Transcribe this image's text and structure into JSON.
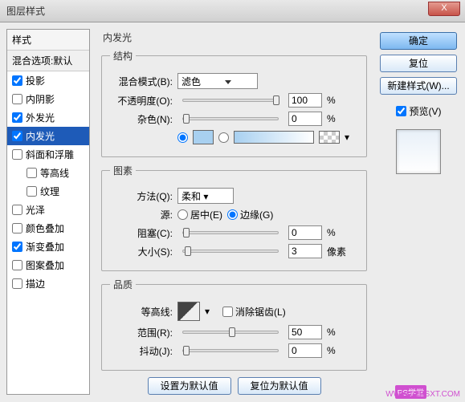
{
  "window": {
    "title": "图层样式",
    "close": "X"
  },
  "styles": {
    "header": "样式",
    "blend_default": "混合选项:默认",
    "items": [
      {
        "label": "投影",
        "checked": true
      },
      {
        "label": "内阴影",
        "checked": false
      },
      {
        "label": "外发光",
        "checked": true
      },
      {
        "label": "内发光",
        "checked": true,
        "selected": true
      },
      {
        "label": "斜面和浮雕",
        "checked": false
      },
      {
        "label": "等高线",
        "checked": false,
        "indent": true
      },
      {
        "label": "纹理",
        "checked": false,
        "indent": true
      },
      {
        "label": "光泽",
        "checked": false
      },
      {
        "label": "颜色叠加",
        "checked": false
      },
      {
        "label": "渐变叠加",
        "checked": true
      },
      {
        "label": "图案叠加",
        "checked": false
      },
      {
        "label": "描边",
        "checked": false
      }
    ]
  },
  "main": {
    "title": "内发光",
    "structure": {
      "legend": "结构",
      "blend_mode_label": "混合模式(B):",
      "blend_mode_value": "滤色",
      "opacity_label": "不透明度(O):",
      "opacity_value": "100",
      "opacity_unit": "%",
      "noise_label": "杂色(N):",
      "noise_value": "0",
      "noise_unit": "%"
    },
    "elements": {
      "legend": "图素",
      "method_label": "方法(Q):",
      "method_value": "柔和",
      "source_label": "源:",
      "source_center": "居中(E)",
      "source_edge": "边缘(G)",
      "choke_label": "阻塞(C):",
      "choke_value": "0",
      "choke_unit": "%",
      "size_label": "大小(S):",
      "size_value": "3",
      "size_unit": "像素"
    },
    "quality": {
      "legend": "品质",
      "contour_label": "等高线:",
      "antialias_label": "消除锯齿(L)",
      "range_label": "范围(R):",
      "range_value": "50",
      "range_unit": "%",
      "jitter_label": "抖动(J):",
      "jitter_value": "0",
      "jitter_unit": "%"
    },
    "buttons": {
      "set_default": "设置为默认值",
      "reset_default": "复位为默认值"
    }
  },
  "right": {
    "ok": "确定",
    "cancel": "复位",
    "new_style": "新建样式(W)...",
    "preview": "预览(V)"
  },
  "watermark": {
    "badge": "PS学堂",
    "url": "WWW.52PSXT.COM"
  }
}
